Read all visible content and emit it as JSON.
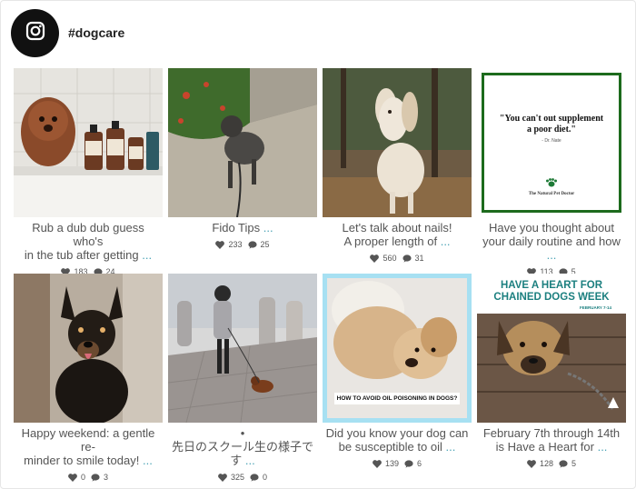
{
  "header": {
    "hashtag": "#dogcare",
    "icon": "instagram-icon"
  },
  "more_label": "...",
  "posts": [
    {
      "caption_lines": [
        "Rub a dub dub guess who's",
        "in the tub after getting"
      ],
      "likes": "183",
      "comments": "24"
    },
    {
      "caption_lines": [
        "Fido Tips"
      ],
      "likes": "233",
      "comments": "25"
    },
    {
      "caption_lines": [
        "Let's talk about nails!",
        "A proper length of"
      ],
      "likes": "560",
      "comments": "31"
    },
    {
      "caption_lines": [
        "Have you thought about",
        "your daily routine and how"
      ],
      "likes": "113",
      "comments": "5",
      "quote": "\"You can't out supplement a poor diet.\"",
      "quote_author": "- Dr. Nate",
      "logo_text": "The Natural Pet Doctor"
    },
    {
      "caption_lines": [
        "Happy weekend: a gentle re-",
        "minder to smile today!"
      ],
      "likes": "0",
      "comments": "3"
    },
    {
      "caption_lines": [
        "•",
        "先日のスクール生の様子で",
        "す"
      ],
      "likes": "325",
      "comments": "0"
    },
    {
      "caption_lines": [
        "Did you know your dog can",
        "be susceptible to oil"
      ],
      "likes": "139",
      "comments": "6",
      "banner": "HOW TO AVOID OIL POISONING IN DOGS?"
    },
    {
      "caption_lines": [
        "February 7th through 14th",
        "is Have a Heart for"
      ],
      "likes": "128",
      "comments": "5",
      "headline": "HAVE A HEART FOR CHAINED DOGS WEEK",
      "subline": "FEBRUARY 7-14"
    }
  ],
  "colors": {
    "link": "#4aa3b5",
    "accent_border": "#a7e0f2",
    "green_border": "#1d6b1d"
  }
}
